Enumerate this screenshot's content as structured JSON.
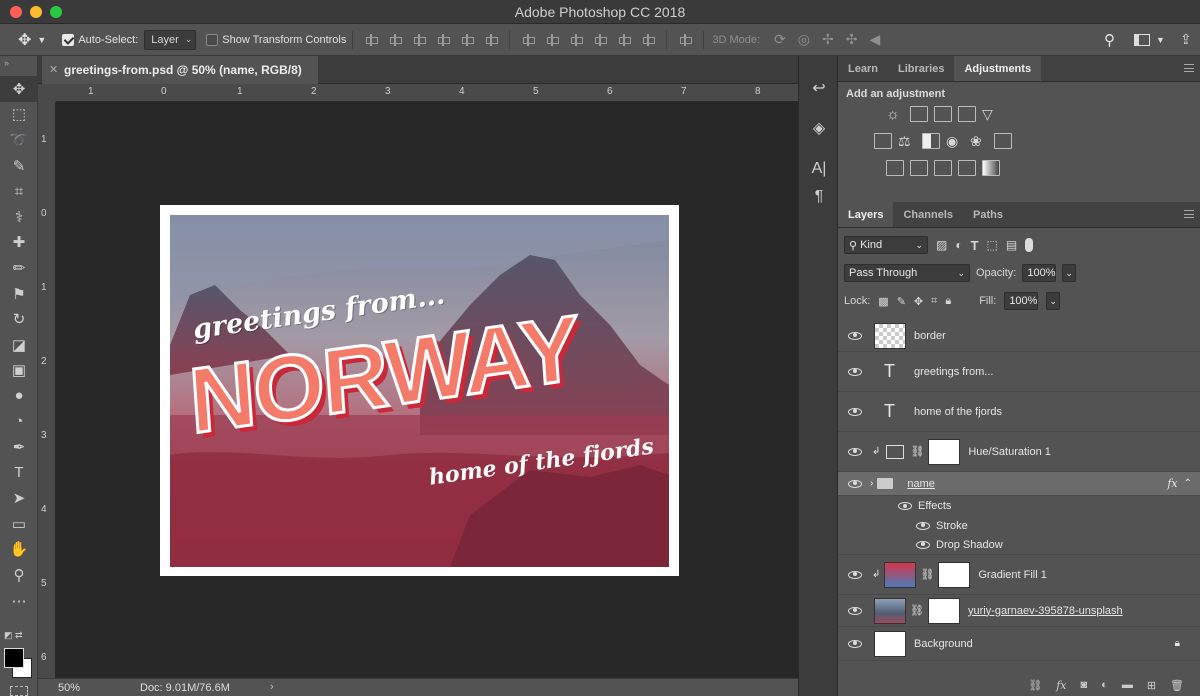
{
  "app": {
    "title": "Adobe Photoshop CC 2018"
  },
  "options_bar": {
    "auto_select_label": "Auto-Select:",
    "auto_select_value": "Layer",
    "show_transform_label": "Show Transform Controls",
    "mode_3d_label": "3D Mode:"
  },
  "document": {
    "tab_title": "greetings-from.psd @ 50% (name, RGB/8)",
    "zoom": "50%",
    "doc_size": "Doc: 9.01M/76.6M"
  },
  "ruler": {
    "h_labels": [
      "1",
      "0",
      "1",
      "2",
      "3",
      "4",
      "5",
      "6",
      "7",
      "8"
    ],
    "v_labels": [
      "1",
      "0",
      "1",
      "2",
      "3",
      "4",
      "5",
      "6"
    ]
  },
  "postcard": {
    "greeting": "greetings from...",
    "country": "NORWAY",
    "tagline": "home of the fjords"
  },
  "top_panel": {
    "tabs": [
      "Learn",
      "Libraries",
      "Adjustments"
    ],
    "active_tab": "Adjustments",
    "add_adjustment_label": "Add an adjustment"
  },
  "layers_panel": {
    "tabs": [
      "Layers",
      "Channels",
      "Paths"
    ],
    "active_tab": "Layers",
    "kind_label": "Kind",
    "blend_mode": "Pass Through",
    "opacity_label": "Opacity:",
    "opacity_value": "100%",
    "lock_label": "Lock:",
    "fill_label": "Fill:",
    "fill_value": "100%",
    "layers": {
      "border": "border",
      "greetings": "greetings from...",
      "home": "home of the fjords",
      "hue": "Hue/Saturation 1",
      "name": "name",
      "effects": "Effects",
      "stroke": "Stroke",
      "drop_shadow": "Drop Shadow",
      "gradient": "Gradient Fill 1",
      "photo": "yuriy-garnaev-395878-unsplash",
      "background": "Background"
    },
    "fx_label": "fx"
  }
}
